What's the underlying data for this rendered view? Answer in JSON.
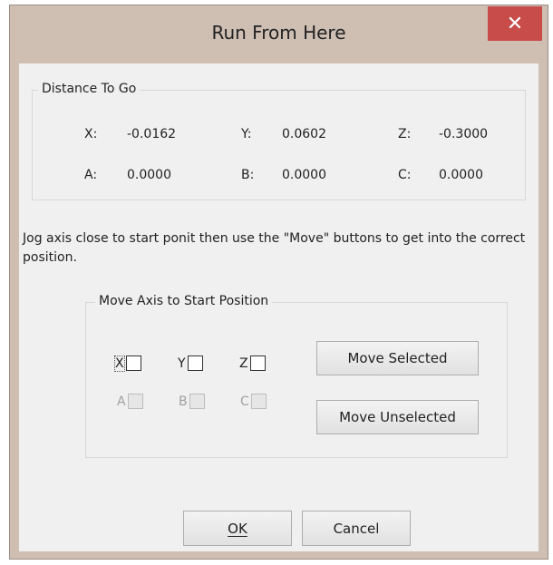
{
  "window": {
    "title": "Run From Here",
    "close_glyph": "✕"
  },
  "distance": {
    "title": "Distance To Go",
    "x_label": "X:",
    "x_value": "-0.0162",
    "y_label": "Y:",
    "y_value": "0.0602",
    "z_label": "Z:",
    "z_value": "-0.3000",
    "a_label": "A:",
    "a_value": "0.0000",
    "b_label": "B:",
    "b_value": "0.0000",
    "c_label": "C:",
    "c_value": "0.0000"
  },
  "instructions": "Jog axis close to start ponit then use the \"Move\" buttons to get into the correct position.",
  "move_group": {
    "title": "Move Axis to Start Position",
    "x": "X",
    "y": "Y",
    "z": "Z",
    "a": "A",
    "b": "B",
    "c": "C",
    "move_selected": "Move Selected",
    "move_unselected": "Move Unselected"
  },
  "buttons": {
    "ok": "OK",
    "cancel": "Cancel"
  }
}
